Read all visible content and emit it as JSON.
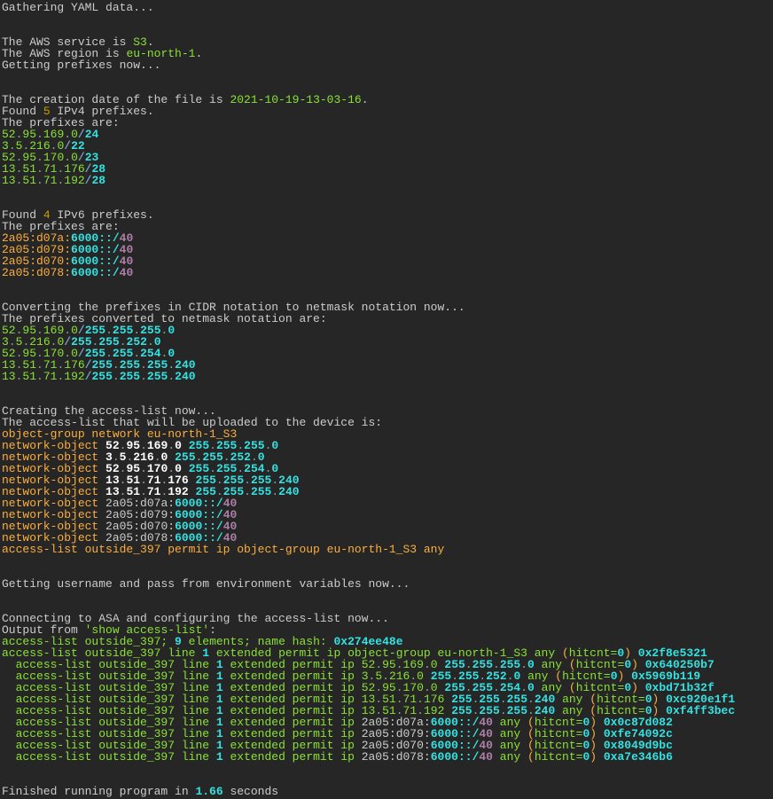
{
  "header": "Gathering YAML data...",
  "aws": {
    "service": "S3",
    "region": "eu-north-1"
  },
  "getting_prefixes": "Getting prefixes now...",
  "creation_date": "2021-10-19-13-03-16",
  "ipv4_count": 5,
  "ipv4_prefixes": [
    {
      "ip": "52.95.169.0",
      "mask": "24"
    },
    {
      "ip": "3.5.216.0",
      "mask": "22"
    },
    {
      "ip": "52.95.170.0",
      "mask": "23"
    },
    {
      "ip": "13.51.71.176",
      "mask": "28"
    },
    {
      "ip": "13.51.71.192",
      "mask": "28"
    }
  ],
  "ipv6_count": 4,
  "ipv6_prefixes": [
    {
      "prefix": "2a05:d07a",
      "port": "6000",
      "sep": "::/",
      "mask": "40"
    },
    {
      "prefix": "2a05:d079",
      "port": "6000",
      "sep": "::/",
      "mask": "40"
    },
    {
      "prefix": "2a05:d070",
      "port": "6000",
      "sep": "::/",
      "mask": "40"
    },
    {
      "prefix": "2a05:d078",
      "port": "6000",
      "sep": "::/",
      "mask": "40"
    }
  ],
  "converting_text1": "Converting the prefixes in CIDR notation to netmask notation now...",
  "converting_text2": "The prefixes converted to netmask notation are:",
  "netmask_prefixes": [
    {
      "ip": "52.95.169.0",
      "mask": "255.255.255.0"
    },
    {
      "ip": "3.5.216.0",
      "mask": "255.255.252.0"
    },
    {
      "ip": "52.95.170.0",
      "mask": "255.255.254.0"
    },
    {
      "ip": "13.51.71.176",
      "mask": "255.255.255.240"
    },
    {
      "ip": "13.51.71.192",
      "mask": "255.255.255.240"
    }
  ],
  "creating_acl_text1": "Creating the access-list now...",
  "creating_acl_text2": "The access-list that will be uploaded to the device is:",
  "object_group": "object-group network eu-north-1_S3",
  "network_objects_v4": [
    {
      "ip": "52.95.169.0",
      "mask": "255.255.255.0"
    },
    {
      "ip": "3.5.216.0",
      "mask": "255.255.252.0"
    },
    {
      "ip": "52.95.170.0",
      "mask": "255.255.254.0"
    },
    {
      "ip": "13.51.71.176",
      "mask": "255.255.255.240"
    },
    {
      "ip": "13.51.71.192",
      "mask": "255.255.255.240"
    }
  ],
  "network_objects_v6": [
    {
      "prefix": "2a05:d07a",
      "port": "6000",
      "mask": "40"
    },
    {
      "prefix": "2a05:d079",
      "port": "6000",
      "mask": "40"
    },
    {
      "prefix": "2a05:d070",
      "port": "6000",
      "mask": "40"
    },
    {
      "prefix": "2a05:d078",
      "port": "6000",
      "mask": "40"
    }
  ],
  "permit_line": "access-list outside_397 permit ip object-group eu-north-1_S3 any",
  "getting_creds": "Getting username and pass from environment variables now...",
  "connecting": "Connecting to ASA and configuring the access-list now...",
  "output_from": "Output from ",
  "show_cmd": "'show access-list'",
  "output_from_suffix": ":",
  "summary": {
    "pre": "access-list outside_397; ",
    "count": "9",
    "post": " elements; name hash: ",
    "hash": "0x274ee48e"
  },
  "acl_header": {
    "pre": "access-list outside_397 line ",
    "line": "1",
    "mid": " extended permit ip object-group eu-north-1_S3 any ",
    "hitcnt": "0",
    "hash": "0x2f8e5321"
  },
  "acl_lines_v4": [
    {
      "ip": "52.95.169.0",
      "mask": "255.255.255.0",
      "hitcnt": "0",
      "hash": "0x640250b7"
    },
    {
      "ip": "3.5.216.0",
      "mask": "255.255.252.0",
      "hitcnt": "0",
      "hash": "0x5969b119"
    },
    {
      "ip": "52.95.170.0",
      "mask": "255.255.254.0",
      "hitcnt": "0",
      "hash": "0xbd71b32f"
    },
    {
      "ip": "13.51.71.176",
      "mask": "255.255.255.240",
      "hitcnt": "0",
      "hash": "0xc920e1f1"
    },
    {
      "ip": "13.51.71.192",
      "mask": "255.255.255.240",
      "hitcnt": "0",
      "hash": "0xf4ff3bec"
    }
  ],
  "acl_lines_v6": [
    {
      "prefix": "2a05:d07a",
      "port": "6000",
      "mask": "40",
      "hitcnt": "0",
      "hash": "0x0c87d082"
    },
    {
      "prefix": "2a05:d079",
      "port": "6000",
      "mask": "40",
      "hitcnt": "0",
      "hash": "0xfe74092c"
    },
    {
      "prefix": "2a05:d070",
      "port": "6000",
      "mask": "40",
      "hitcnt": "0",
      "hash": "0x8049d9bc"
    },
    {
      "prefix": "2a05:d078",
      "port": "6000",
      "mask": "40",
      "hitcnt": "0",
      "hash": "0xa7e346b6"
    }
  ],
  "finished": {
    "pre": "Finished running program in ",
    "time": "1.66",
    "post": " seconds"
  }
}
